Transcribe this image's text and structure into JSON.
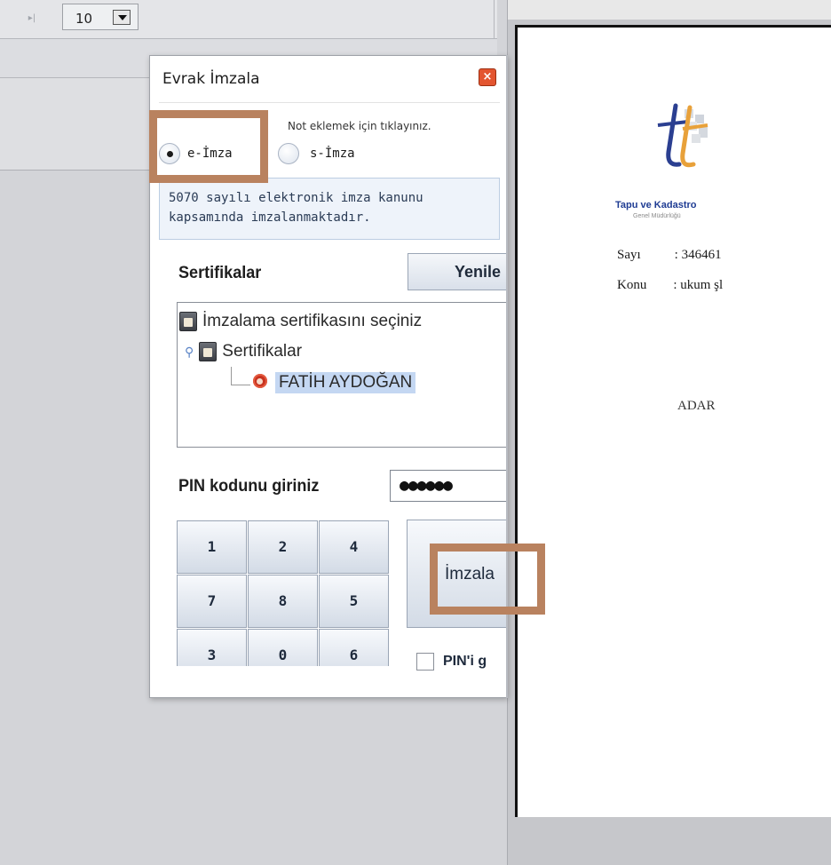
{
  "toolbar": {
    "last_page_icon": "▸|",
    "page_size": "10"
  },
  "dialog": {
    "title": "Evrak İmzala",
    "close_icon": "×",
    "note_link": "Not eklemek için tıklayınız.",
    "sign_types": [
      {
        "label": "e-İmza",
        "selected": true
      },
      {
        "label": "s-İmza",
        "selected": false
      }
    ],
    "info_lines": [
      "5070 sayılı elektronik imza kanunu",
      "kapsamında imzalanmaktadır."
    ],
    "certificates_label": "Sertifikalar",
    "refresh_label": "Yenile",
    "tree": {
      "root": "İmzalama sertifikasını seçiniz",
      "group": "Sertifikalar",
      "item": "FATİH AYDOĞAN"
    },
    "pin_label": "PIN kodunu giriniz",
    "pin_value": "●●●●●●",
    "keypad": [
      "1",
      "2",
      "4",
      "7",
      "8",
      "5",
      "3",
      "0",
      "6"
    ],
    "sign_button": "İmzala",
    "remember_pin": "PIN'i g"
  },
  "document": {
    "org_name": "Tapu ve Kadastro",
    "org_sub": "Genel Müdürlüğü",
    "sayi_label": "Sayı",
    "sayi_value": ": 346461",
    "konu_label": "Konu",
    "konu_value": ": ukum şl",
    "fragment": "ADAR"
  },
  "colors": {
    "highlight_box": "#b9825f",
    "dialog_close": "#e35530",
    "selection": "#c4d7f2"
  }
}
